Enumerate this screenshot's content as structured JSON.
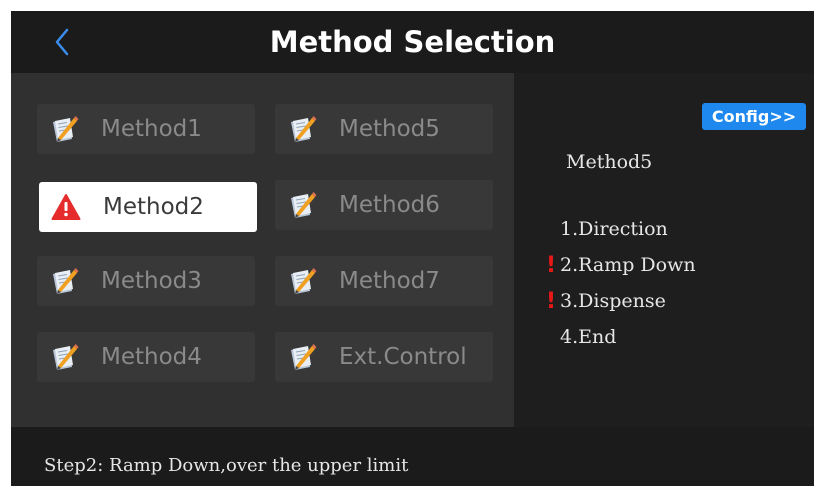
{
  "header": {
    "title": "Method Selection",
    "back_icon": "chevron-left-icon"
  },
  "methods": [
    {
      "label": "Method1",
      "icon": "notepad-edit-icon",
      "state": "normal"
    },
    {
      "label": "Method5",
      "icon": "notepad-edit-icon",
      "state": "normal"
    },
    {
      "label": "Method2",
      "icon": "warning-triangle-icon",
      "state": "selected"
    },
    {
      "label": "Method6",
      "icon": "notepad-edit-icon",
      "state": "normal"
    },
    {
      "label": "Method3",
      "icon": "notepad-edit-icon",
      "state": "normal"
    },
    {
      "label": "Method7",
      "icon": "notepad-edit-icon",
      "state": "normal"
    },
    {
      "label": "Method4",
      "icon": "notepad-edit-icon",
      "state": "normal"
    },
    {
      "label": "Ext.Control",
      "icon": "notepad-edit-icon",
      "state": "normal"
    }
  ],
  "detail": {
    "config_label": "Config>>",
    "method_name": "Method5",
    "warning_mark": "!",
    "steps": [
      {
        "text": "1.Direction",
        "warning": false
      },
      {
        "text": "2.Ramp Down",
        "warning": true
      },
      {
        "text": "3.Dispense",
        "warning": true
      },
      {
        "text": "4.End",
        "warning": false
      }
    ]
  },
  "footer": {
    "status": "Step2: Ramp Down,over the upper limit"
  },
  "colors": {
    "accent": "#1e88ee",
    "warning": "#e81818",
    "background": "#2b2b2b"
  }
}
